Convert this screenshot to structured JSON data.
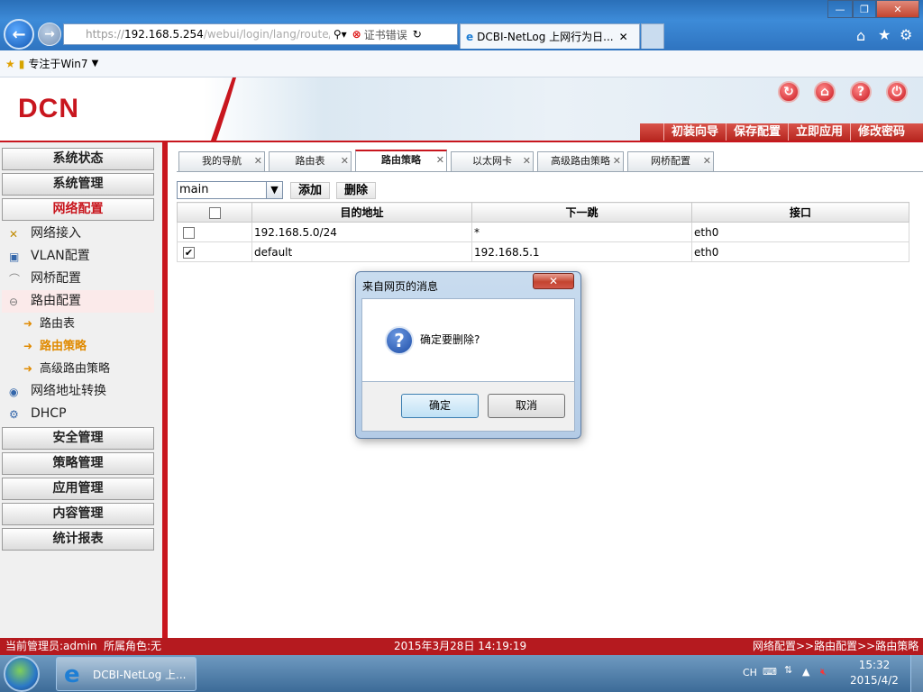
{
  "browser": {
    "url_scheme": "https://",
    "url_host": "192.168.5.254",
    "url_rest": "/webui/login/lang/route/index",
    "cert_error": "证书错误",
    "tab_title": "DCBI-NetLog 上网行为日...",
    "favorites_label": "专注于Win7"
  },
  "header": {
    "logo": "DCN",
    "actions": [
      "初装向导",
      "保存配置",
      "立即应用",
      "修改密码"
    ]
  },
  "sidebar": {
    "top_buttons": [
      "系统状态",
      "系统管理",
      "网络配置"
    ],
    "network_items": [
      "网络接入",
      "VLAN配置",
      "网桥配置",
      "路由配置"
    ],
    "route_items": [
      "路由表",
      "路由策略",
      "高级路由策略"
    ],
    "more_items": [
      "网络地址转换",
      "DHCP"
    ],
    "bottom_buttons": [
      "安全管理",
      "策略管理",
      "应用管理",
      "内容管理",
      "统计报表"
    ]
  },
  "tabs": [
    "我的导航",
    "路由表",
    "路由策略",
    "以太网卡",
    "高级路由策略",
    "网桥配置"
  ],
  "toolbar": {
    "select_value": "main",
    "add_label": "添加",
    "delete_label": "删除"
  },
  "table": {
    "headers": [
      "目的地址",
      "下一跳",
      "接口"
    ],
    "rows": [
      {
        "checked": false,
        "dest": "192.168.5.0/24",
        "next_hop": "*",
        "iface": "eth0"
      },
      {
        "checked": true,
        "dest": "default",
        "next_hop": "192.168.5.1",
        "iface": "eth0"
      }
    ]
  },
  "dialog": {
    "title": "来自网页的消息",
    "message": "确定要删除?",
    "ok_label": "确定",
    "cancel_label": "取消"
  },
  "status": {
    "admin": "当前管理员:admin",
    "role": "所属角色:无",
    "datetime": "2015年3月28日 14:19:19",
    "breadcrumb": "网络配置>>路由配置>>路由策略"
  },
  "taskbar": {
    "task_label": "DCBI-NetLog 上...",
    "lang": "CH",
    "time": "15:32",
    "date": "2015/4/2"
  },
  "colors": {
    "brand_red": "#c8161e",
    "accent_orange": "#e08a00"
  }
}
